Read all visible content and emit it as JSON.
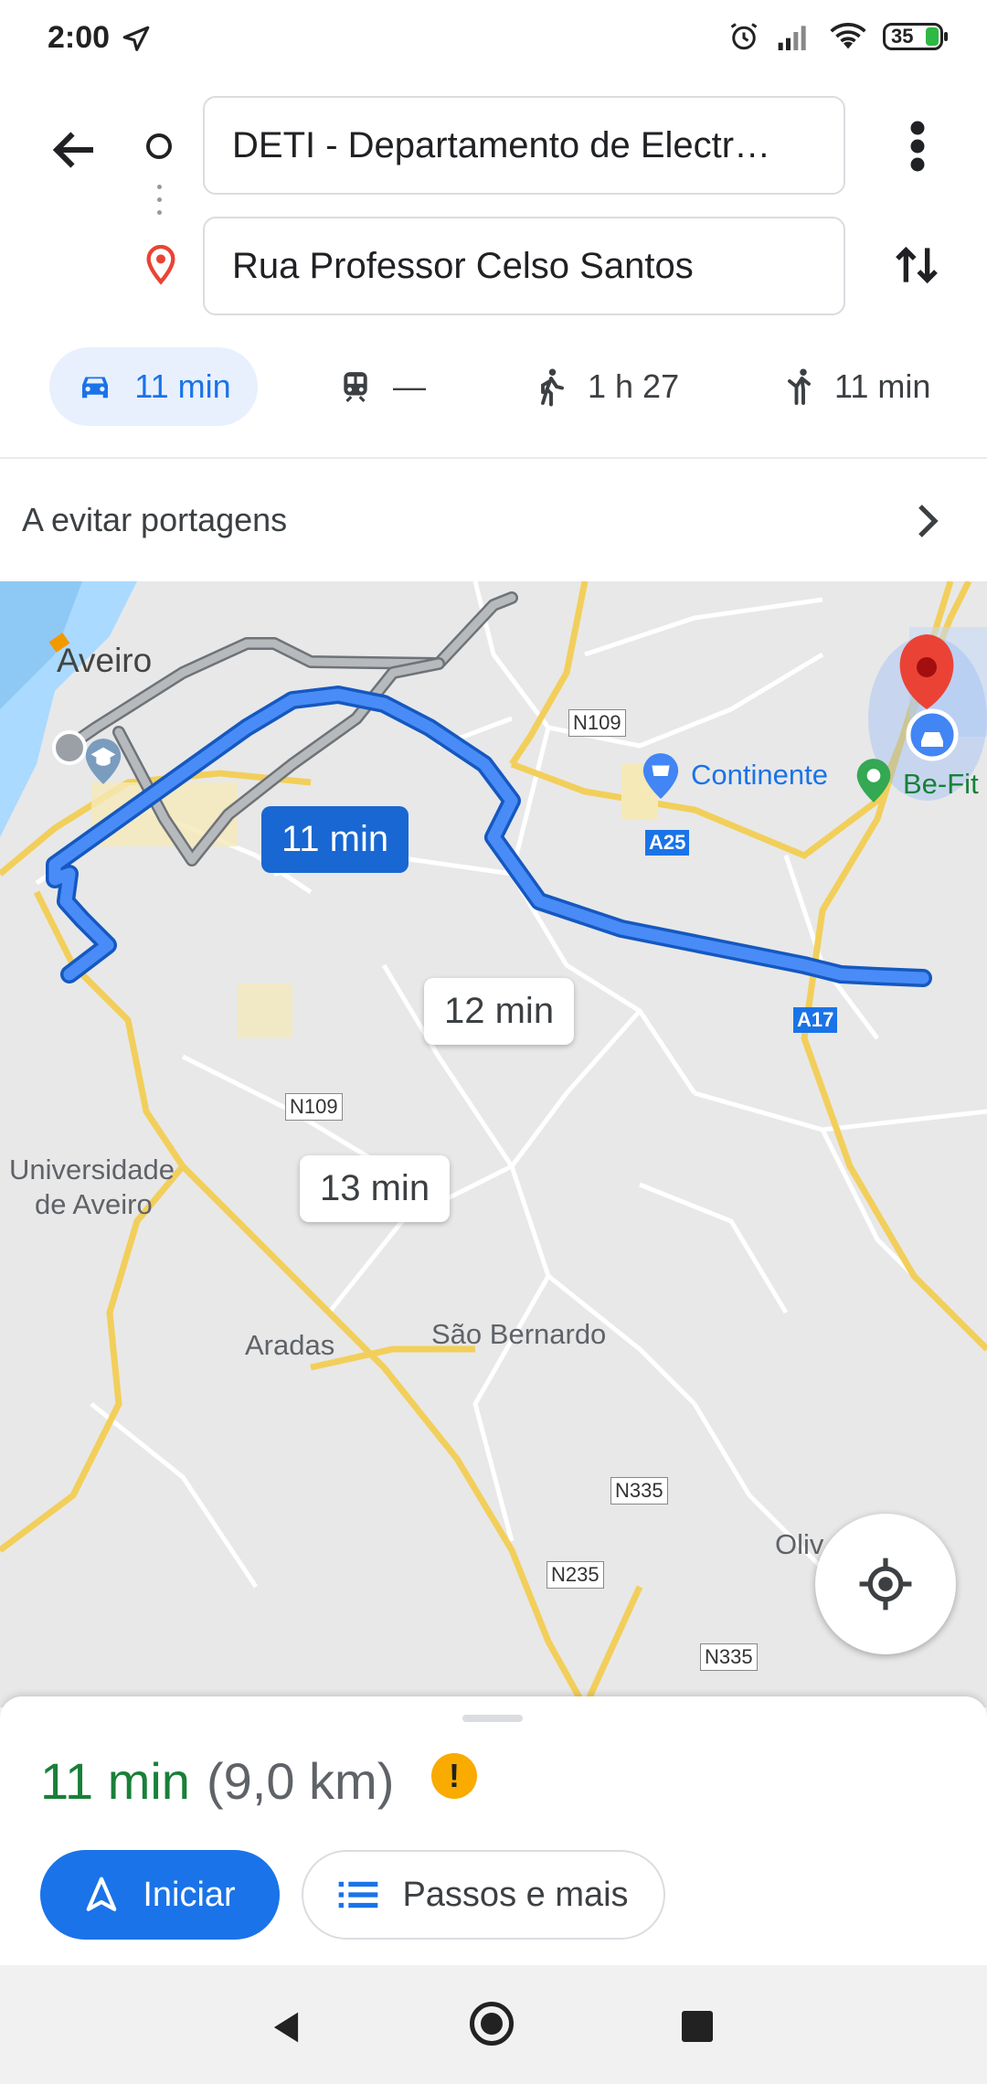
{
  "status_bar": {
    "time": "2:00",
    "battery": "35"
  },
  "header": {
    "origin": "DETI - Departamento de Electr…",
    "destination": "Rua Professor Celso Santos"
  },
  "modes": [
    {
      "name": "car",
      "label": "11 min",
      "active": true
    },
    {
      "name": "transit",
      "label": "—"
    },
    {
      "name": "walk",
      "label": "1 h 27"
    },
    {
      "name": "ride",
      "label": "11 min"
    }
  ],
  "options": {
    "avoid_label": "A evitar portagens"
  },
  "map": {
    "places": {
      "aveiro": "Aveiro",
      "universidade_1": "Universidade",
      "universidade_2": "de Aveiro",
      "aradas": "Aradas",
      "sao_bernardo": "São Bernardo",
      "continente": "Continente",
      "befit": "Be-Fit",
      "oliv": "Oliv"
    },
    "roads": {
      "n109_top": "N109",
      "n109_mid": "N109",
      "a25": "A25",
      "a17": "A17",
      "n335_a": "N335",
      "n235": "N235",
      "n335_b": "N335"
    },
    "routes": {
      "selected": "11 min",
      "alt1": "12 min",
      "alt2": "13 min"
    }
  },
  "sheet": {
    "eta": "11 min",
    "distance": "(9,0 km)",
    "warning": "!",
    "start_label": "Iniciar",
    "steps_label": "Passos e mais"
  },
  "colors": {
    "accent": "#1a73e8",
    "route_selected": "#4285f4",
    "route_alt": "#9aa0a6",
    "eta_green": "#188038",
    "warning": "#f9ab00"
  }
}
